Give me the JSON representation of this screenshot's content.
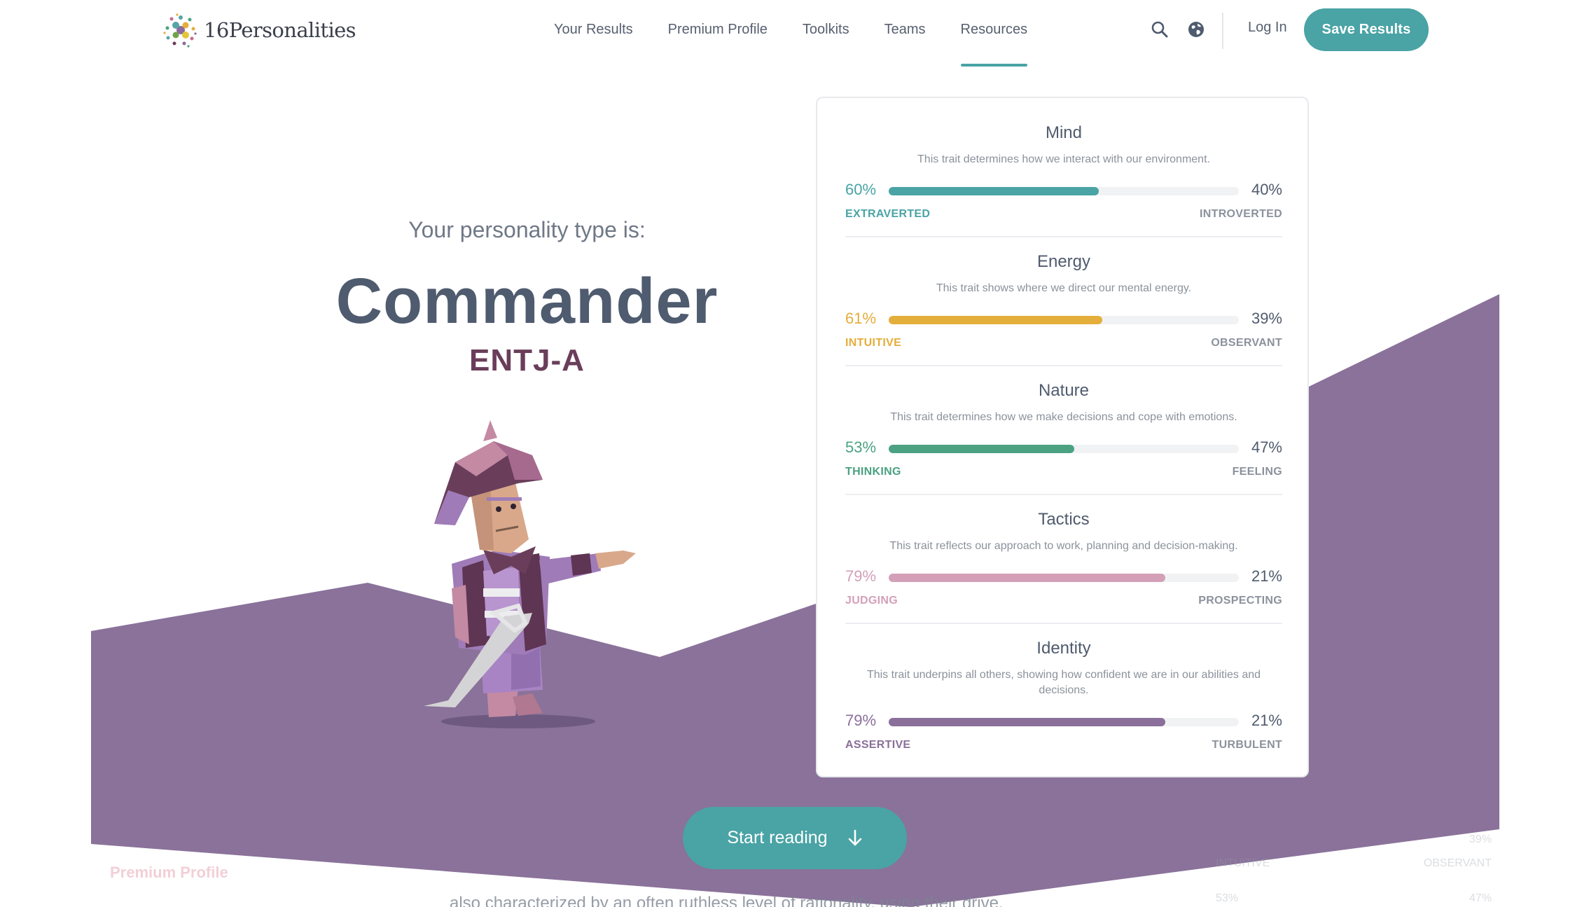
{
  "nav": {
    "brand_number": "16",
    "brand_word": "Personalities",
    "links": [
      "Your Results",
      "Premium Profile",
      "Toolkits",
      "Teams",
      "Resources"
    ],
    "active_link": "Resources",
    "search_icon": "search-icon",
    "language_icon": "globe-icon",
    "login": "Log In",
    "save": "Save Results"
  },
  "hero": {
    "intro": "Your personality type is:",
    "type_name": "Commander",
    "type_code": "ENTJ-A"
  },
  "traits": [
    {
      "title": "Mind",
      "desc": "This trait determines how we interact with our environment.",
      "left_pct": "60%",
      "right_pct": "40%",
      "left_label": "EXTRAVERTED",
      "right_label": "INTROVERTED",
      "value": 60,
      "color": "#4aa3a5"
    },
    {
      "title": "Energy",
      "desc": "This trait shows where we direct our mental energy.",
      "left_pct": "61%",
      "right_pct": "39%",
      "left_label": "INTUITIVE",
      "right_label": "OBSERVANT",
      "value": 61,
      "color": "#e4ae3a"
    },
    {
      "title": "Nature",
      "desc": "This trait determines how we make decisions and cope with emotions.",
      "left_pct": "53%",
      "right_pct": "47%",
      "left_label": "THINKING",
      "right_label": "FEELING",
      "value": 53,
      "color": "#4ba282"
    },
    {
      "title": "Tactics",
      "desc": "This trait reflects our approach to work, planning and decision-making.",
      "left_pct": "79%",
      "right_pct": "21%",
      "left_label": "JUDGING",
      "right_label": "PROSPECTING",
      "value": 79,
      "color": "#d3a0b8"
    },
    {
      "title": "Identity",
      "desc": "This trait underpins all others, showing how confident we are in our abilities and decisions.",
      "left_pct": "79%",
      "right_pct": "21%",
      "left_label": "ASSERTIVE",
      "right_label": "TURBULENT",
      "value": 79,
      "color": "#8a6f9a"
    }
  ],
  "cta": {
    "start_reading": "Start reading",
    "arrow_icon": "arrow-down-icon"
  },
  "below": {
    "premium_label": "Premium Profile",
    "body_snippet": "also characterized by an often ruthless level of rationality, using their drive,",
    "ghost_pct_top": "39%",
    "ghost_label_left": "INTUITIVE",
    "ghost_label_right": "OBSERVANT",
    "ghost_pct_left": "53%",
    "ghost_pct_right": "47%"
  },
  "colors": {
    "accent": "#4aa3a5",
    "purple_bg": "#8a729a",
    "type_code": "#6a3e5a"
  }
}
